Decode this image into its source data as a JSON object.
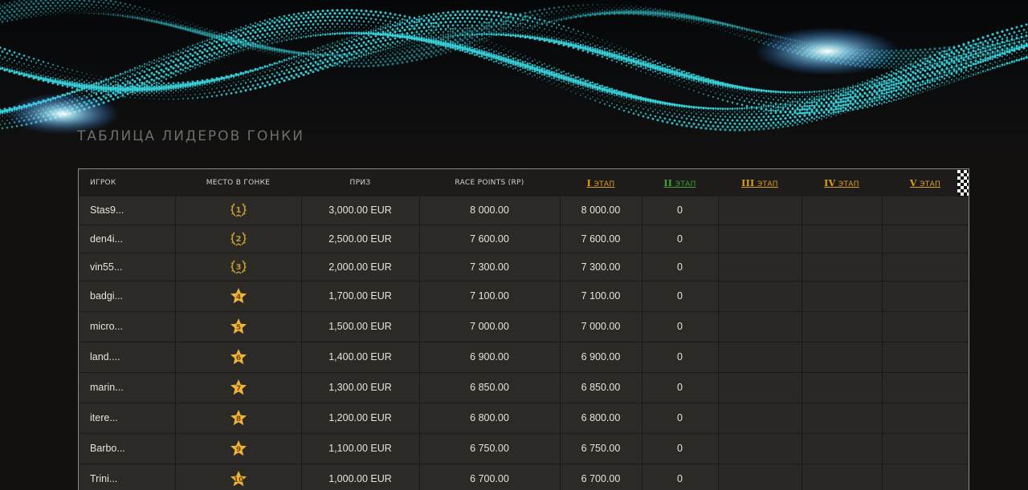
{
  "page": {
    "title": "ТАБЛИЦА ЛИДЕРОВ ГОНКИ"
  },
  "colors": {
    "accent_orange": "#e0a020",
    "accent_green": "#3fa23a",
    "medal_gold": "#c39a34",
    "star_gold": "#f0b33a",
    "particles": "#39d3dc"
  },
  "table": {
    "headers": {
      "player": "ИГРОК",
      "place": "МЕСТО В ГОНКЕ",
      "prize": "ПРИЗ",
      "points": "RACE POINTS (RP)"
    },
    "stages": [
      {
        "numeral": "I",
        "word": "этап",
        "color": "#e0a020"
      },
      {
        "numeral": "II",
        "word": "этап",
        "color": "#3fa23a"
      },
      {
        "numeral": "III",
        "word": "этап",
        "color": "#e0a020"
      },
      {
        "numeral": "IV",
        "word": "этап",
        "color": "#e0a020"
      },
      {
        "numeral": "V",
        "word": "этап",
        "color": "#e0a020"
      }
    ],
    "rows": [
      {
        "player": "Stas9...",
        "place": 1,
        "badge": "medal-icon",
        "prize": "3,000.00 EUR",
        "points": "8 000.00",
        "stage1": "8 000.00",
        "stage2": "0"
      },
      {
        "player": "den4i...",
        "place": 2,
        "badge": "medal-icon",
        "prize": "2,500.00 EUR",
        "points": "7 600.00",
        "stage1": "7 600.00",
        "stage2": "0"
      },
      {
        "player": "vin55...",
        "place": 3,
        "badge": "medal-icon",
        "prize": "2,000.00 EUR",
        "points": "7 300.00",
        "stage1": "7 300.00",
        "stage2": "0"
      },
      {
        "player": "badgi...",
        "place": 4,
        "badge": "star-icon",
        "prize": "1,700.00 EUR",
        "points": "7 100.00",
        "stage1": "7 100.00",
        "stage2": "0"
      },
      {
        "player": "micro...",
        "place": 5,
        "badge": "star-icon",
        "prize": "1,500.00 EUR",
        "points": "7 000.00",
        "stage1": "7 000.00",
        "stage2": "0"
      },
      {
        "player": "land....",
        "place": 6,
        "badge": "star-icon",
        "prize": "1,400.00 EUR",
        "points": "6 900.00",
        "stage1": "6 900.00",
        "stage2": "0"
      },
      {
        "player": "marin...",
        "place": 7,
        "badge": "star-icon",
        "prize": "1,300.00 EUR",
        "points": "6 850.00",
        "stage1": "6 850.00",
        "stage2": "0"
      },
      {
        "player": "itere...",
        "place": 8,
        "badge": "star-icon",
        "prize": "1,200.00 EUR",
        "points": "6 800.00",
        "stage1": "6 800.00",
        "stage2": "0"
      },
      {
        "player": "Barbo...",
        "place": 9,
        "badge": "star-icon",
        "prize": "1,100.00 EUR",
        "points": "6 750.00",
        "stage1": "6 750.00",
        "stage2": "0"
      },
      {
        "player": "Trini...",
        "place": 10,
        "badge": "star-icon",
        "prize": "1,000.00 EUR",
        "points": "6 700.00",
        "stage1": "6 700.00",
        "stage2": "0"
      }
    ]
  }
}
